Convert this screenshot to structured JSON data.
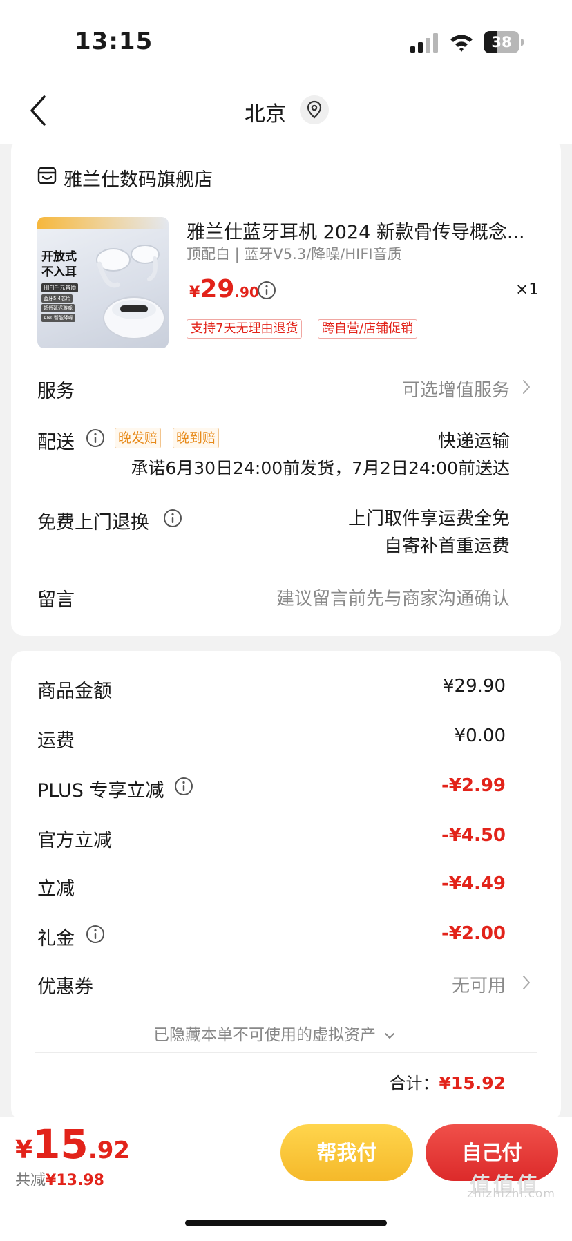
{
  "status_bar": {
    "time": "13:15",
    "battery": 38
  },
  "nav": {
    "title": "北京"
  },
  "shop": {
    "name": "雅兰仕数码旗舰店"
  },
  "product": {
    "image_badge_line1": "开放式",
    "image_badge_line2": "不入耳",
    "image_badge_sub": "HIFI千元音质",
    "image_bullets": [
      "蓝牙5.4芯片",
      "超低延迟游戏",
      "ANC智能降噪"
    ],
    "title": "雅兰仕蓝牙耳机 2024 新款骨传导概念...",
    "spec": "顶配白 | 蓝牙V5.3/降噪/HIFI音质",
    "price_symbol": "¥",
    "price_int": "29",
    "price_dec": ".90",
    "quantity": "×1",
    "tags": [
      "支持7天无理由退货",
      "跨自营/店铺促销"
    ]
  },
  "service": {
    "label": "服务",
    "value": "可选增值服务"
  },
  "delivery": {
    "label": "配送",
    "tags": [
      "晚发赔",
      "晚到赔"
    ],
    "method": "快递运输",
    "promise": "承诺6月30日24:00前发货，7月2日24:00前送达"
  },
  "return": {
    "label": "免费上门退换",
    "line1": "上门取件享运费全免",
    "line2": "自寄补首重运费"
  },
  "message": {
    "label": "留言",
    "placeholder": "建议留言前先与商家沟通确认"
  },
  "summary": {
    "goods_label": "商品金额",
    "goods_value": "¥29.90",
    "shipping_label": "运费",
    "shipping_value": "¥0.00",
    "plus_label": "PLUS 专享立减",
    "plus_value": "-¥2.99",
    "official_label": "官方立减",
    "official_value": "-¥4.50",
    "direct_label": "立减",
    "direct_value": "-¥4.49",
    "gift_label": "礼金",
    "gift_value": "-¥2.00",
    "coupon_label": "优惠券",
    "coupon_value": "无可用",
    "hidden_assets": "已隐藏本单不可使用的虚拟资产",
    "total_label": "合计：",
    "total_value": "¥15.92"
  },
  "bottom": {
    "total_symbol": "¥",
    "total_int": "15",
    "total_dec": ".92",
    "saving_label": "共减",
    "saving_value": "¥13.98",
    "help_pay": "帮我付",
    "self_pay": "自己付"
  },
  "watermark": {
    "big": "值值值",
    "site": "zhizhizhi.com"
  },
  "colors": {
    "accent_red": "#e2231a",
    "help_yellow": "#f5b92a",
    "pay_red": "#dc2a2a",
    "tag_orange": "#e78a1a"
  }
}
